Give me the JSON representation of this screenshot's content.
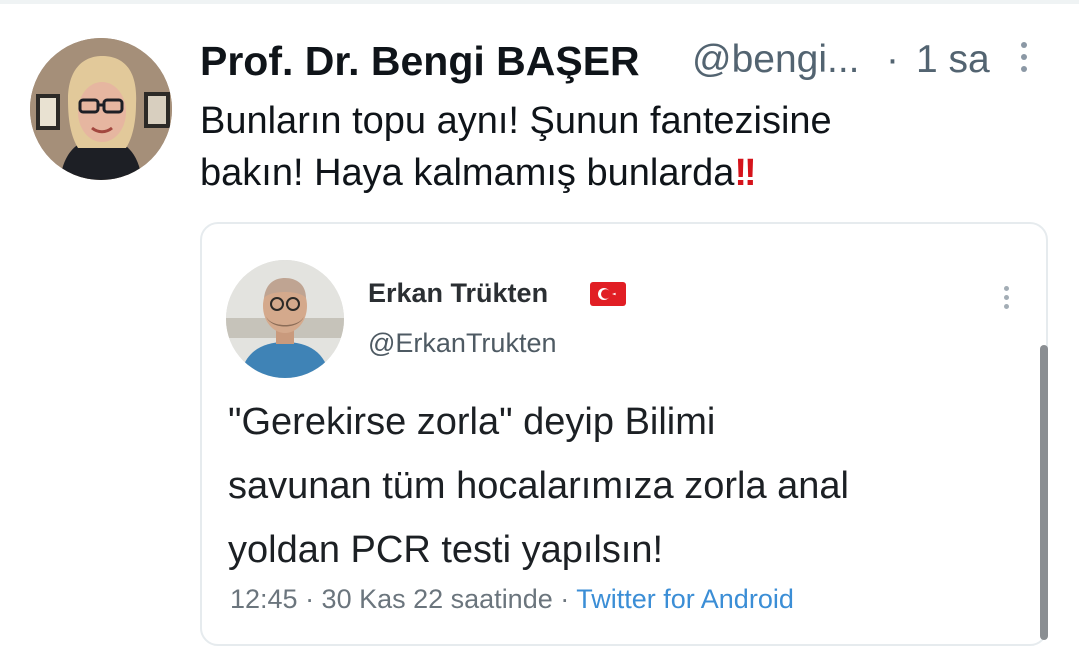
{
  "tweet": {
    "author_name": "Prof. Dr. Bengi BAŞER",
    "author_handle": "@bengi...",
    "separator": "·",
    "time": "1 sa",
    "text_line1": "Bunların topu aynı! Şunun fantezisine",
    "text_line2": "bakın! Haya kalmamış bunlarda",
    "emphasis": "!!"
  },
  "quoted_tweet": {
    "author_name": "Erkan Trükten",
    "author_handle": "@ErkanTrukten",
    "text_line1": "\"Gerekirse zorla\" deyip Bilimi",
    "text_line2": "savunan tüm hocalarımıza zorla anal",
    "text_line3": "yoldan PCR testi yapılsın!",
    "meta": "12:45 · 30 Kas 22 saatinde · ",
    "source": "Twitter for Android"
  },
  "icons": {
    "author_avatar": "avatar",
    "more": "more-vertical-icon",
    "flag": "turkey-flag-icon"
  },
  "colors": {
    "text": "#0f1419",
    "secondary": "#536471",
    "link": "#3b8ed6",
    "flag": "#e11e24",
    "emphasis": "#d5131b"
  }
}
